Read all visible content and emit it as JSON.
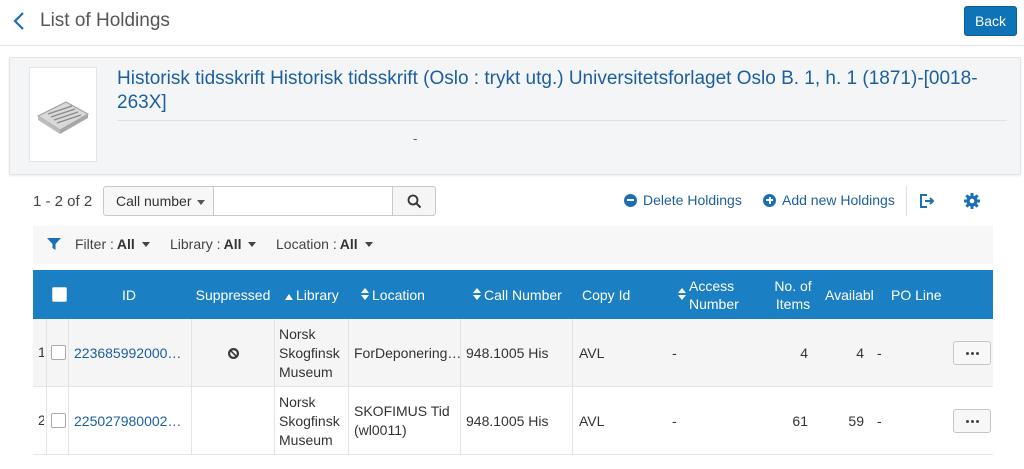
{
  "header": {
    "title": "List of Holdings",
    "back_label": "Back"
  },
  "record": {
    "title": "Historisk tidsskrift Historisk tidsskrift (Oslo : trykt utg.) Universitetsforlaget Oslo B. 1, h. 1 (1871)-[0018-263X]",
    "subtitle": "-"
  },
  "toolbar": {
    "count": "1 - 2 of 2",
    "search_field": "Call number",
    "search_value": "",
    "delete_label": "Delete Holdings",
    "add_label": "Add new Holdings",
    "icons": [
      "minus-circle-icon",
      "plus-circle-icon",
      "export-icon",
      "gear-icon",
      "search-icon"
    ]
  },
  "filters": {
    "filter_label": "Filter :",
    "filter_value": "All",
    "library_label": "Library :",
    "library_value": "All",
    "location_label": "Location :",
    "location_value": "All"
  },
  "table": {
    "columns": {
      "id": "ID",
      "suppressed": "Suppressed",
      "library": "Library",
      "location": "Location",
      "call_number": "Call Number",
      "copy_id": "Copy Id",
      "access_number_1": "Access",
      "access_number_2": "Number",
      "items_1": "No. of",
      "items_2": "Items",
      "available": "Availabl",
      "po_line": "PO Line"
    },
    "rows": [
      {
        "num": "1",
        "id": "223685992000…",
        "suppressed": true,
        "library_1": "Norsk",
        "library_2": "Skogfinsk",
        "library_3": "Museum",
        "location_1": "ForDeponering…",
        "location_2": "",
        "call_number": "948.1005 His",
        "copy_id": "AVL",
        "access_number": "-",
        "items": "4",
        "available": "4",
        "po_line": "-"
      },
      {
        "num": "2",
        "id": "225027980002…",
        "suppressed": false,
        "library_1": "Norsk",
        "library_2": "Skogfinsk",
        "library_3": "Museum",
        "location_1": "SKOFIMUS Tid",
        "location_2": "(wl0011)",
        "call_number": "948.1005 His",
        "copy_id": "AVL",
        "access_number": "-",
        "items": "61",
        "available": "59",
        "po_line": "-"
      }
    ]
  },
  "colors": {
    "primary": "#1b7fc4",
    "button": "#0f73b8",
    "link": "#1d5f9e"
  }
}
